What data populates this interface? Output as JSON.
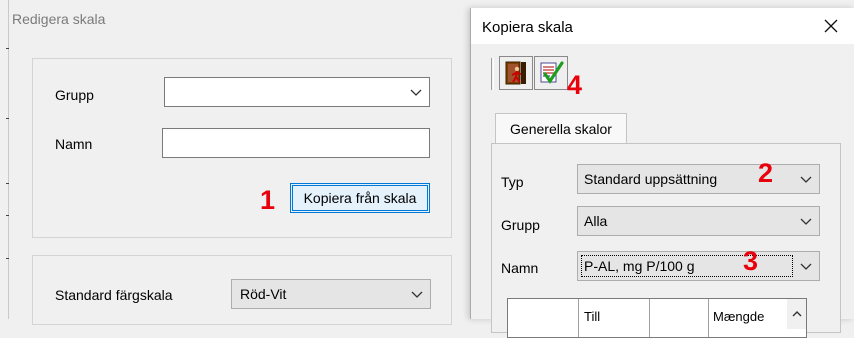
{
  "left_window": {
    "title": "Redigera skala",
    "grupp_label": "Grupp",
    "grupp_value": "",
    "namn_label": "Namn",
    "namn_value": "",
    "copy_button_label": "Kopiera från skala",
    "annotation_1": "1",
    "standard_color_label": "Standard färgskala",
    "standard_color_value": "Röd-Vit"
  },
  "dialog": {
    "title": "Kopiera skala",
    "close_glyph": "✕",
    "toolbar": {
      "exit_icon": "exit-door-icon",
      "ok_icon": "checklist-ok-icon"
    },
    "annotation_4": "4",
    "tab_label": "Generella skalor",
    "typ_label": "Typ",
    "typ_value": "Standard uppsättning",
    "annotation_2": "2",
    "grupp_label": "Grupp",
    "grupp_value": "Alla",
    "namn_label": "Namn",
    "namn_value": "P-AL, mg P/100 g",
    "annotation_3": "3",
    "grid_headers": [
      "Till",
      "Mængde"
    ]
  },
  "colors": {
    "annotation_red": "#e8000b",
    "focus_blue": "#0078d7"
  }
}
